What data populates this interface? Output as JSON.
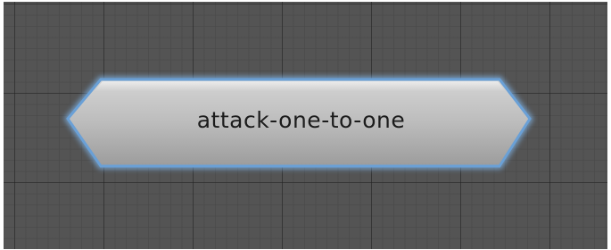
{
  "graph": {
    "node": {
      "label": "attack-one-to-one",
      "state": "selected",
      "shape": "hexagon"
    }
  },
  "colors": {
    "canvas": "#545454",
    "node_fill_top": "#d2d2d2",
    "node_fill_bottom": "#9e9e9e",
    "selection_outline": "#6fa3d8"
  }
}
